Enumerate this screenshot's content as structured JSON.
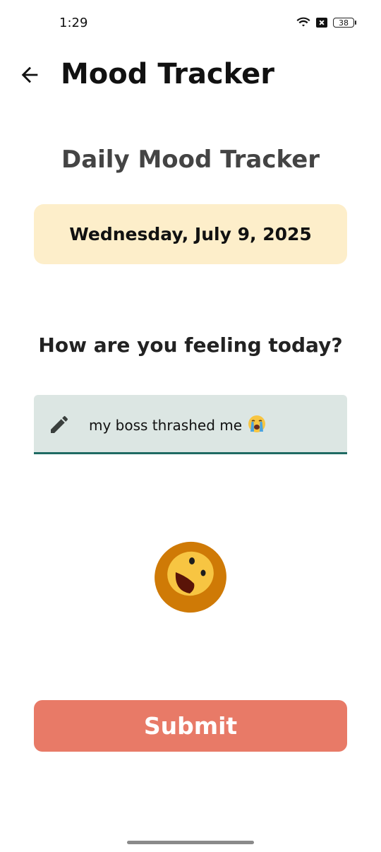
{
  "status_bar": {
    "time": "1:29",
    "battery_level": "38",
    "icons": [
      "wifi-icon",
      "sim-blocked-icon",
      "battery-icon"
    ]
  },
  "app_bar": {
    "title": "Mood Tracker",
    "back_icon": "arrow-left-icon"
  },
  "tracker": {
    "heading": "Daily Mood Tracker",
    "date": "Wednesday, July 9, 2025",
    "question": "How are you feeling today?",
    "mood_input": {
      "value": "my boss thrashed me",
      "value_emoji": "loudly-crying-face",
      "icon": "pencil-icon"
    },
    "detected_mood_icon": "laughing-face-emoji",
    "submit_label": "Submit"
  },
  "colors": {
    "date_card_bg": "#fdeeca",
    "input_bg": "#dce6e3",
    "input_underline": "#1f6b63",
    "submit_bg": "#e87a67",
    "submit_text": "#ffffff"
  }
}
